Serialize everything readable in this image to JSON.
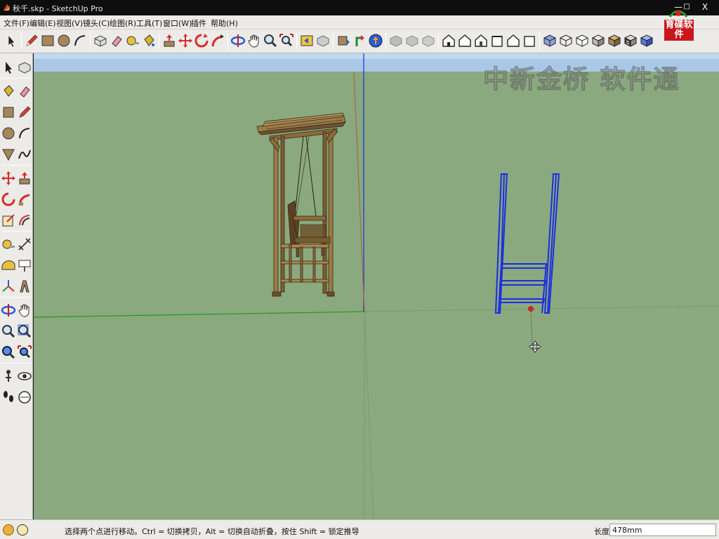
{
  "window": {
    "title": "秋千.skp - SketchUp Pro",
    "minimize_icon": "minimize-icon",
    "maximize_icon": "maximize-icon",
    "close_label": "X"
  },
  "menu": [
    "文件(F)",
    "编辑(E)",
    "视图(V)",
    "镜头(C)",
    "绘图(R)",
    "工具(T)",
    "窗口(W)",
    "插件",
    "帮助(H)"
  ],
  "toolbar_icons": [
    "select-icon",
    "pencil-icon",
    "rectangle-icon",
    "circle-icon",
    "arc-icon",
    "make-component-icon",
    "eraser-icon",
    "tape-measure-icon",
    "paint-bucket-icon",
    "push-pull-icon",
    "move-icon",
    "rotate-icon",
    "follow-me-icon",
    "orbit-icon",
    "pan-icon",
    "zoom-icon",
    "zoom-extents-icon",
    "previous-view-icon",
    "next-view-icon",
    "get-models-icon",
    "share-model-icon",
    "upload-component-icon",
    "iso-view-icon",
    "top-view-icon",
    "front-view-icon",
    "right-view-icon",
    "back-view-icon",
    "left-view-icon",
    "xray-icon",
    "wireframe-icon",
    "hidden-line-icon",
    "shaded-icon",
    "shaded-textures-icon",
    "monochrome-icon"
  ],
  "left_toolbar_icons": [
    "select-icon",
    "make-component-icon",
    "paint-bucket-icon",
    "eraser-icon",
    "rectangle-icon",
    "line-icon",
    "circle-icon",
    "arc-icon",
    "polygon-icon",
    "freehand-icon",
    "move-icon",
    "push-pull-icon",
    "rotate-icon",
    "follow-me-icon",
    "scale-icon",
    "offset-icon",
    "tape-measure-icon",
    "dimension-icon",
    "protractor-icon",
    "text-icon",
    "axes-icon",
    "3d-text-icon",
    "orbit-icon",
    "pan-icon",
    "zoom-icon",
    "zoom-window-icon",
    "previous-view-icon",
    "zoom-extents-icon",
    "position-camera-icon",
    "look-around-icon",
    "walk-icon",
    "section-plane-icon"
  ],
  "watermark": {
    "text": "中新金桥 软件通",
    "logo_text": "育碟软件"
  },
  "viewport": {
    "sky_color": "#a9c8e8",
    "ground_color": "#8aa97f",
    "selection_color": "#1b2ee0"
  },
  "status": {
    "message": "选择两个点进行移动。Ctrl = 切换拷贝，Alt = 切换自动折叠，按住 Shift = 锁定推导",
    "measure_label": "长度",
    "measure_value": "478mm",
    "geo_icon": "geo-location-icon",
    "credits_icon": "credits-icon"
  }
}
